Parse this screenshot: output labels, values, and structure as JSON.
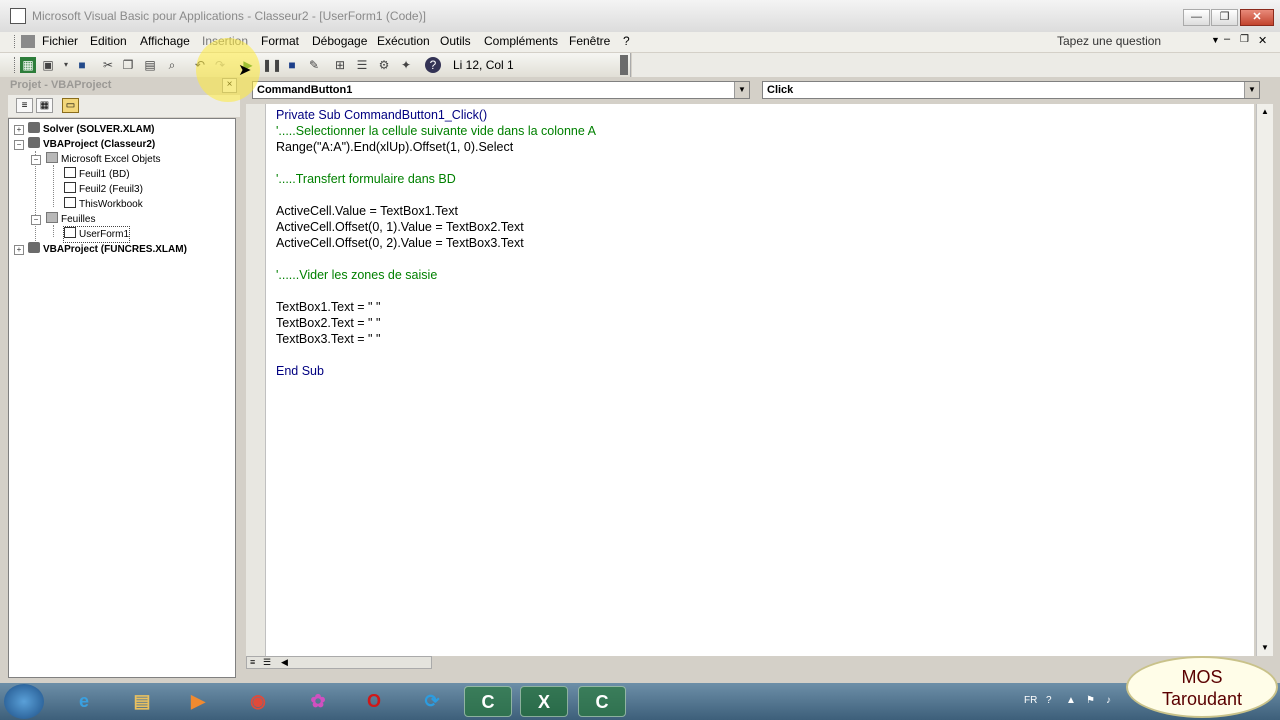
{
  "window": {
    "title": "Microsoft Visual Basic pour Applications - Classeur2 - [UserForm1 (Code)]",
    "min_label": "—",
    "max_label": "❐",
    "close_label": "✕"
  },
  "menu": {
    "items": [
      "Fichier",
      "Edition",
      "Affichage",
      "Insertion",
      "Format",
      "Débogage",
      "Exécution",
      "Outils",
      "Compléments",
      "Fenêtre",
      "?"
    ],
    "question_placeholder": "Tapez une question",
    "mdi_min": "–",
    "mdi_restore": "❐",
    "mdi_close": "✕"
  },
  "toolbar": {
    "icons": [
      "excel-icon",
      "insert-userform-icon",
      "save-icon",
      "cut-icon",
      "copy-icon",
      "paste-icon",
      "find-icon",
      "undo-icon",
      "redo-icon",
      "run-icon",
      "pause-icon",
      "reset-icon",
      "design-mode-icon",
      "project-explorer-icon",
      "properties-icon",
      "object-browser-icon",
      "toolbox-icon",
      "help-icon"
    ],
    "position_label": "Li 12, Col 1"
  },
  "project_panel": {
    "title": "Projet - VBAProject",
    "close_label": "×",
    "tools": [
      "view-code-icon",
      "view-object-icon",
      "toggle-folders-icon"
    ],
    "tree": [
      {
        "label": "Solver (SOLVER.XLAM)",
        "bold": true,
        "level": 0,
        "expander": "+",
        "icon": "vba"
      },
      {
        "label": "VBAProject (Classeur2)",
        "bold": true,
        "level": 0,
        "expander": "−",
        "icon": "vba"
      },
      {
        "label": "Microsoft Excel Objets",
        "bold": false,
        "level": 1,
        "expander": "−",
        "icon": "folder"
      },
      {
        "label": "Feuil1 (BD)",
        "bold": false,
        "level": 2,
        "expander": "",
        "icon": "sheet"
      },
      {
        "label": "Feuil2 (Feuil3)",
        "bold": false,
        "level": 2,
        "expander": "",
        "icon": "sheet"
      },
      {
        "label": "ThisWorkbook",
        "bold": false,
        "level": 2,
        "expander": "",
        "icon": "sheet"
      },
      {
        "label": "Feuilles",
        "bold": false,
        "level": 1,
        "expander": "−",
        "icon": "folder"
      },
      {
        "label": "UserForm1",
        "bold": false,
        "level": 2,
        "expander": "",
        "icon": "form",
        "selected": true
      },
      {
        "label": "VBAProject (FUNCRES.XLAM)",
        "bold": true,
        "level": 0,
        "expander": "+",
        "icon": "vba"
      }
    ]
  },
  "code_window": {
    "object_combo": "CommandButton1",
    "procedure_combo": "Click",
    "lines": [
      {
        "text": "Private Sub CommandButton1_Click()",
        "kind": "kw"
      },
      {
        "text": "'.....Selectionner la cellule suivante vide dans la colonne A",
        "kind": "cmt"
      },
      {
        "text": "Range(\"A:A\").End(xlUp).Offset(1, 0).Select",
        "kind": "txt"
      },
      {
        "text": "",
        "kind": "txt"
      },
      {
        "text": "'.....Transfert formulaire dans BD",
        "kind": "cmt"
      },
      {
        "text": "",
        "kind": "txt"
      },
      {
        "text": "ActiveCell.Value = TextBox1.Text",
        "kind": "txt"
      },
      {
        "text": "ActiveCell.Offset(0, 1).Value = TextBox2.Text",
        "kind": "txt"
      },
      {
        "text": "ActiveCell.Offset(0, 2).Value = TextBox3.Text",
        "kind": "txt"
      },
      {
        "text": "",
        "kind": "txt"
      },
      {
        "text": "'......Vider les zones de saisie",
        "kind": "cmt"
      },
      {
        "text": "",
        "kind": "txt"
      },
      {
        "text": "TextBox1.Text = \" \"",
        "kind": "txt"
      },
      {
        "text": "TextBox2.Text = \" \"",
        "kind": "txt"
      },
      {
        "text": "TextBox3.Text = \" \"",
        "kind": "txt"
      },
      {
        "text": "",
        "kind": "txt"
      },
      {
        "text": "End Sub",
        "kind": "kw"
      }
    ]
  },
  "taskbar": {
    "items": [
      {
        "name": "internet-explorer-icon",
        "glyph": "e",
        "color": "#3aa0e0",
        "active": false
      },
      {
        "name": "file-explorer-icon",
        "glyph": "▤",
        "color": "#e8c060",
        "active": false
      },
      {
        "name": "media-player-icon",
        "glyph": "▶",
        "color": "#f08a30",
        "active": false
      },
      {
        "name": "chrome-icon",
        "glyph": "◉",
        "color": "#e04a3a",
        "active": false
      },
      {
        "name": "paint-icon",
        "glyph": "✿",
        "color": "#d050c0",
        "active": false
      },
      {
        "name": "opera-icon",
        "glyph": "O",
        "color": "#d01818",
        "active": false
      },
      {
        "name": "sync-icon",
        "glyph": "⟳",
        "color": "#2c9ce0",
        "active": false
      },
      {
        "name": "camtasia-icon",
        "glyph": "C",
        "color": "#ffffff",
        "active": true
      },
      {
        "name": "excel-icon",
        "glyph": "X",
        "color": "#ffffff",
        "active": true
      },
      {
        "name": "camtasia-recorder-icon",
        "glyph": "C",
        "color": "#ffffff",
        "active": true
      }
    ],
    "tray": [
      "FR",
      "?",
      "▲",
      "⚑",
      "♪"
    ]
  },
  "watermark": {
    "line1": "MOS",
    "line2": "Taroudant"
  }
}
